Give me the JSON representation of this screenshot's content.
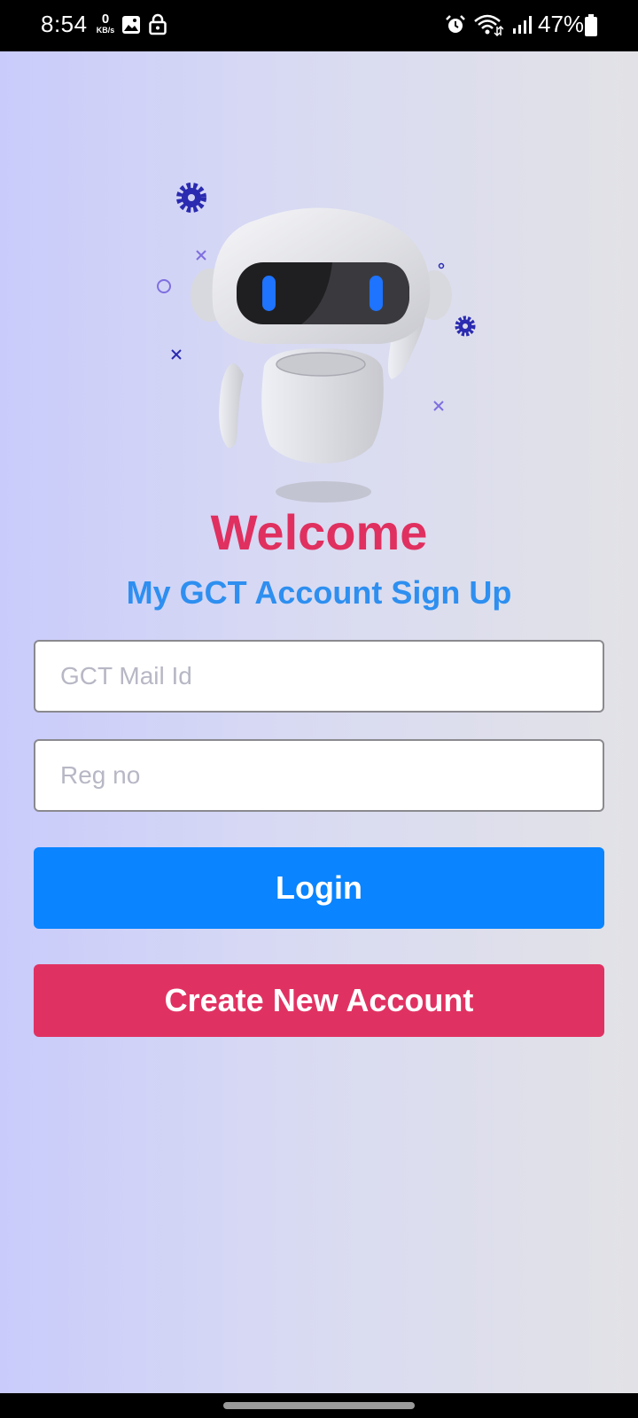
{
  "status_bar": {
    "time": "8:54",
    "network_speed_value": "0",
    "network_speed_unit": "KB/s",
    "battery_percent": "47%",
    "icons": [
      "image-icon",
      "lock-icon",
      "alarm-icon",
      "wifi-icon",
      "signal-icon",
      "battery-icon"
    ]
  },
  "illustration": {
    "name": "robot-illustration",
    "accent_color": "#1e73ff"
  },
  "welcome": {
    "title": "Welcome",
    "subtitle": "My GCT Account Sign Up"
  },
  "form": {
    "email": {
      "placeholder": "GCT Mail Id",
      "value": ""
    },
    "reg_no": {
      "placeholder": "Reg no",
      "value": ""
    }
  },
  "buttons": {
    "login": "Login",
    "create_account": "Create New Account"
  },
  "colors": {
    "title": "#e03060",
    "subtitle": "#2e8ff0",
    "login_button": "#0a84ff",
    "create_button": "#e03262"
  }
}
